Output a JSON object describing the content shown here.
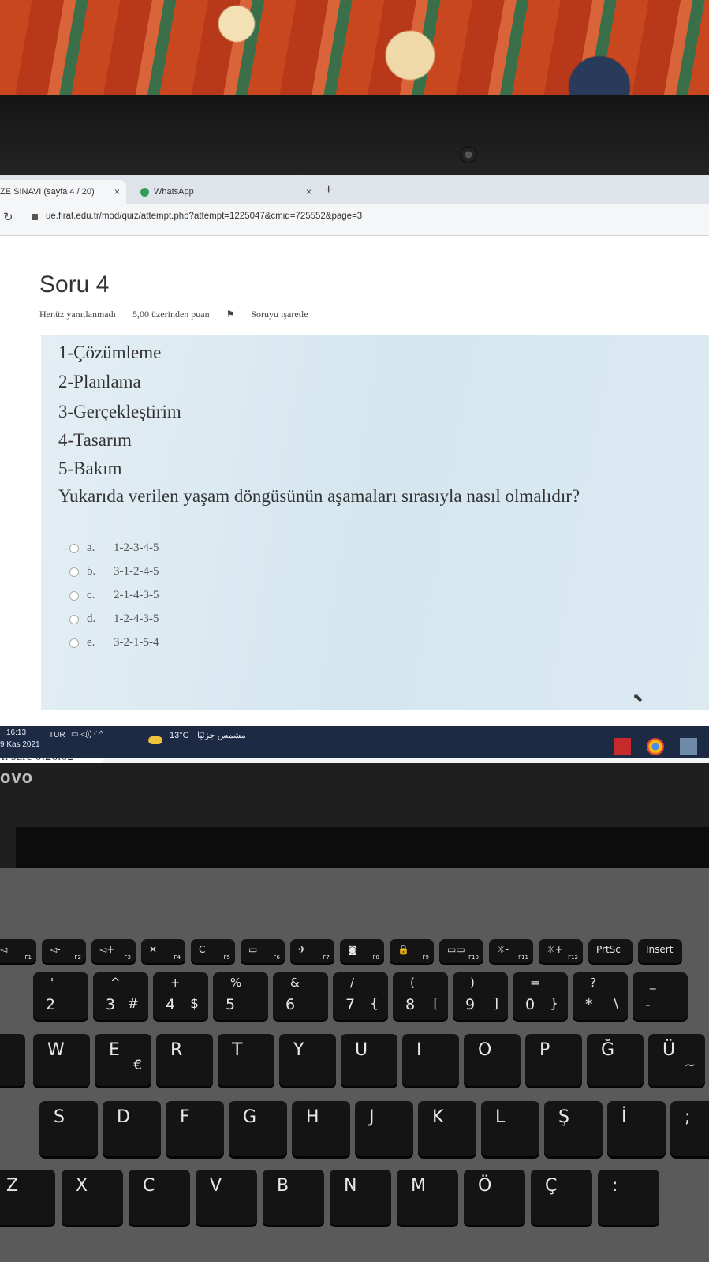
{
  "browser": {
    "tabs": [
      {
        "label": "ZE SINAVI (sayfa 4 / 20)",
        "close": "×"
      },
      {
        "label": "WhatsApp",
        "close": "×"
      }
    ],
    "new_tab": "+",
    "url": "ue.firat.edu.tr/mod/quiz/attempt.php?attempt=1225047&cmid=725552&page=3"
  },
  "question": {
    "title": "Soru 4",
    "status": "Henüz yanıtlanmadı",
    "points": "5,00 üzerinden puan",
    "flag": "Soruyu işaretle",
    "lines": [
      "1-Çözümleme",
      "2-Planlama",
      "3-Gerçekleştirim",
      "4-Tasarım",
      "5-Bakım"
    ],
    "prompt": "Yukarıda verilen yaşam döngüsünün aşamaları sırasıyla nasıl olmalıdır?",
    "options": [
      {
        "letter": "a.",
        "text": "1-2-3-4-5"
      },
      {
        "letter": "b.",
        "text": "3-1-2-4-5"
      },
      {
        "letter": "c.",
        "text": "2-1-4-3-5"
      },
      {
        "letter": "d.",
        "text": "1-2-4-3-5"
      },
      {
        "letter": "e.",
        "text": "3-2-1-5-4"
      }
    ]
  },
  "timer": "n süre 0:26:02",
  "taskbar": {
    "time": "16:13",
    "date": "9 Kas 2021",
    "lang": "TUR",
    "weather": "13°C",
    "weather_text": "مشمس جزئيًا"
  },
  "laptop_brand": "ovo",
  "keyboard": {
    "fkeys": [
      {
        "label": "◅",
        "fn": "F1"
      },
      {
        "label": "◅-",
        "fn": "F2"
      },
      {
        "label": "◅+",
        "fn": "F3"
      },
      {
        "label": "✕",
        "fn": "F4"
      },
      {
        "label": "C",
        "fn": "F5"
      },
      {
        "label": "▭",
        "fn": "F6"
      },
      {
        "label": "✈",
        "fn": "F7"
      },
      {
        "label": "◙",
        "fn": "F8"
      },
      {
        "label": "🔒",
        "fn": "F9"
      },
      {
        "label": "▭▭",
        "fn": "F10"
      },
      {
        "label": "☼-",
        "fn": "F11"
      },
      {
        "label": "☼+",
        "fn": "F12"
      },
      {
        "label": "PrtSc",
        "fn": ""
      },
      {
        "label": "Insert",
        "fn": ""
      }
    ],
    "numrow": [
      {
        "top": "'",
        "bot": "2",
        "alt": ""
      },
      {
        "top": "^",
        "bot": "3",
        "alt": "#"
      },
      {
        "top": "+",
        "bot": "4",
        "alt": "$"
      },
      {
        "top": "%",
        "bot": "5",
        "alt": ""
      },
      {
        "top": "&",
        "bot": "6",
        "alt": ""
      },
      {
        "top": "/",
        "bot": "7",
        "alt": "{"
      },
      {
        "top": "(",
        "bot": "8",
        "alt": "["
      },
      {
        "top": ")",
        "bot": "9",
        "alt": "]"
      },
      {
        "top": "=",
        "bot": "0",
        "alt": "}"
      },
      {
        "top": "?",
        "bot": "*",
        "alt": "\\"
      },
      {
        "top": "_",
        "bot": "-",
        "alt": ""
      }
    ],
    "qrow": [
      {
        "main": "W",
        "alt": ""
      },
      {
        "main": "E",
        "alt": "€"
      },
      {
        "main": "R",
        "alt": ""
      },
      {
        "main": "T",
        "alt": ""
      },
      {
        "main": "Y",
        "alt": ""
      },
      {
        "main": "U",
        "alt": ""
      },
      {
        "main": "I",
        "alt": ""
      },
      {
        "main": "O",
        "alt": ""
      },
      {
        "main": "P",
        "alt": ""
      },
      {
        "main": "Ğ",
        "alt": ""
      },
      {
        "main": "Ü",
        "alt": "~"
      }
    ],
    "arow": [
      "S",
      "D",
      "F",
      "G",
      "H",
      "J",
      "K",
      "L",
      "Ş",
      "İ",
      ";"
    ],
    "zrow": [
      "X",
      "C",
      "V",
      "B",
      "N",
      "M",
      "Ö",
      "Ç",
      ":"
    ],
    "left_edge": {
      "at": "@",
      "z": "Z"
    }
  }
}
